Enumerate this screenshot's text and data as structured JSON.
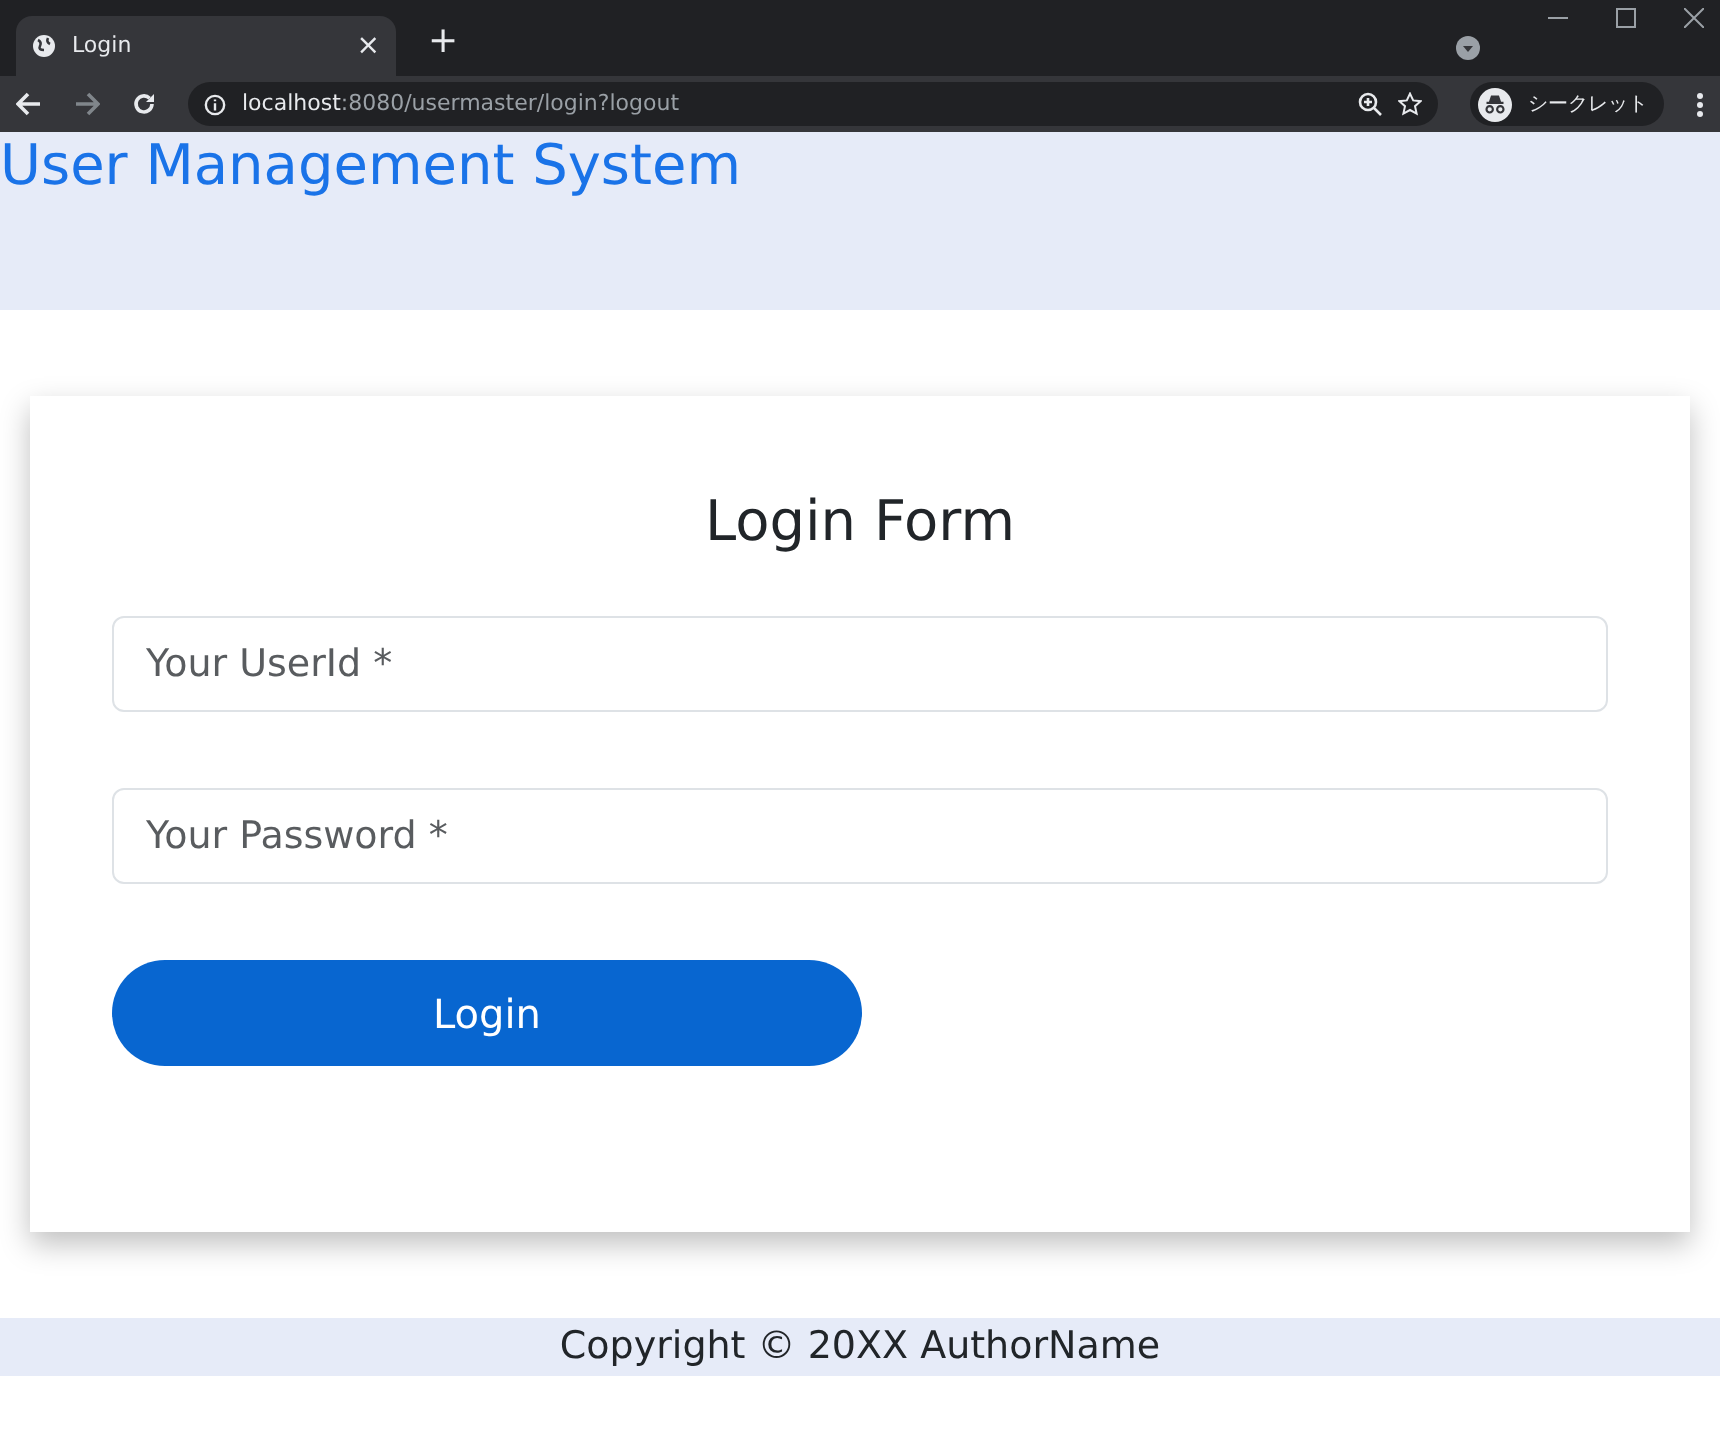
{
  "browser": {
    "tab_title": "Login",
    "tab_close": "×",
    "new_tab": "+",
    "url_host": "localhost",
    "url_path": ":8080/usermaster/login?logout",
    "profile_label": "シークレット"
  },
  "header": {
    "title": "User Management System"
  },
  "form": {
    "title": "Login Form",
    "fields": [
      {
        "placeholder": "Your UserId *"
      },
      {
        "placeholder": "Your Password *"
      }
    ],
    "submit": "Login"
  },
  "footer": {
    "text": "Copyright © 20XX AuthorName"
  }
}
